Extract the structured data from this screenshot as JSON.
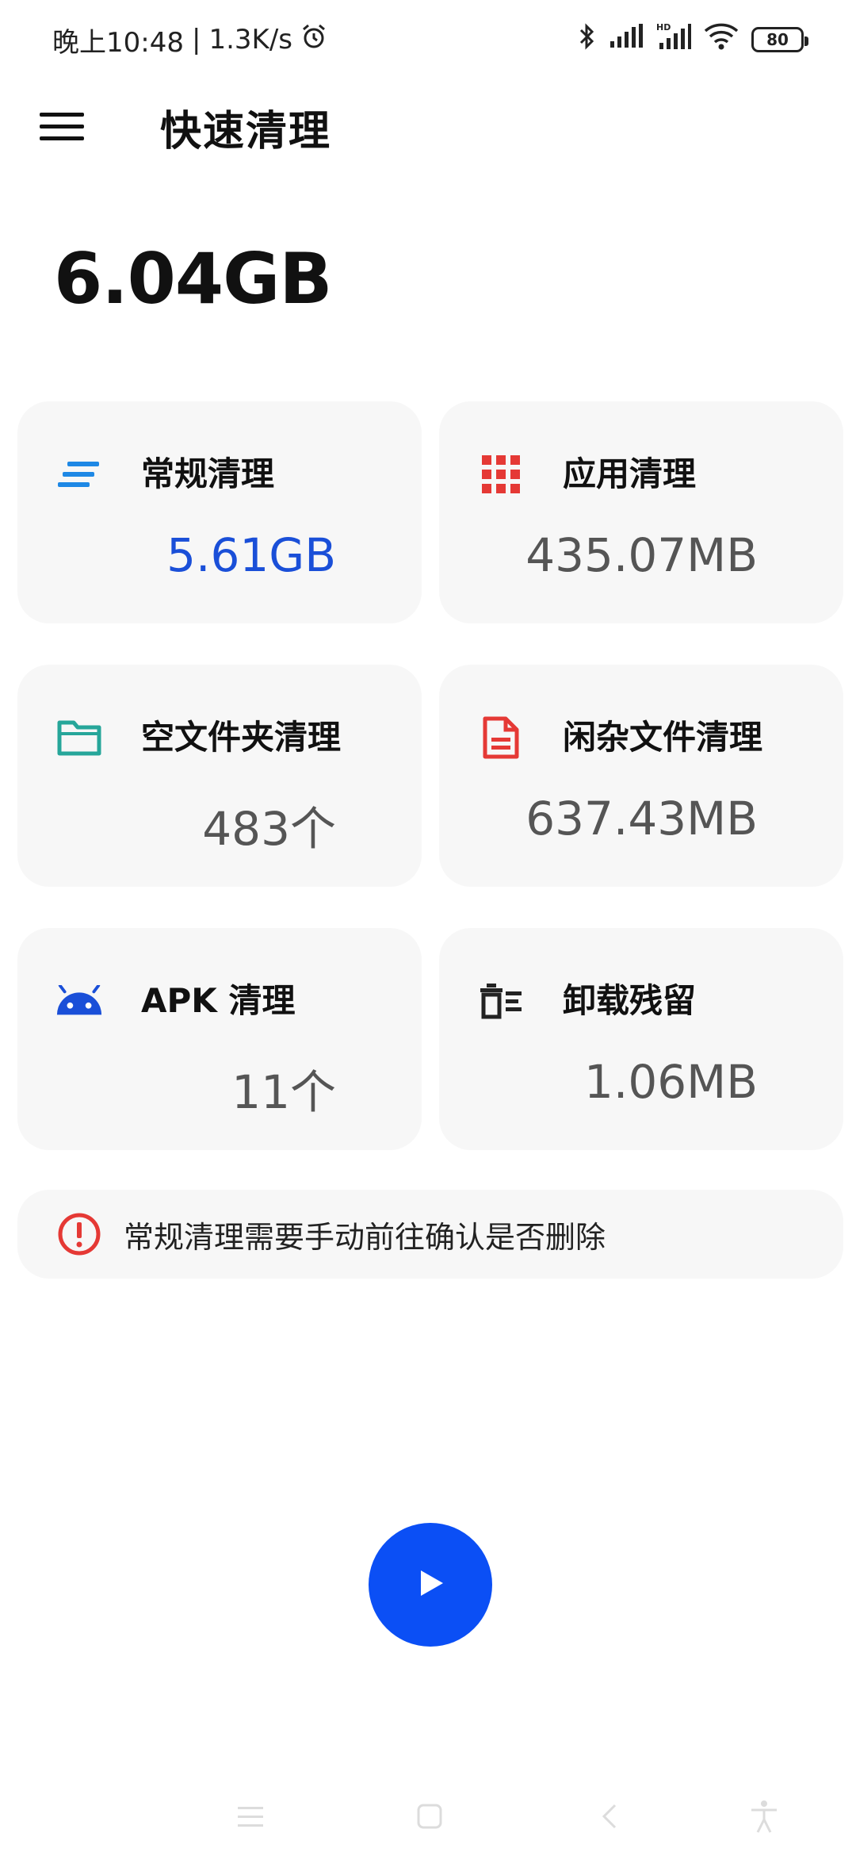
{
  "status_bar": {
    "time": "晚上10:48",
    "separator": "|",
    "network_speed": "1.3K/s",
    "battery": "80",
    "icons": [
      "alarm-icon",
      "bluetooth-icon",
      "signal-icon",
      "hd-signal-icon",
      "wifi-icon",
      "battery-icon"
    ]
  },
  "app_bar": {
    "title": "快速清理",
    "menu_icon": "menu-icon"
  },
  "summary": {
    "total_size": "6.04GB"
  },
  "cards": [
    {
      "title": "常规清理",
      "value": "5.61GB",
      "icon": "lines-icon",
      "value_color": "#1a4fd8"
    },
    {
      "title": "应用清理",
      "value": "435.07MB",
      "icon": "app-grid-icon"
    },
    {
      "title": "空文件夹清理",
      "value": "483个",
      "icon": "folder-icon"
    },
    {
      "title": "闲杂文件清理",
      "value": "637.43MB",
      "icon": "document-icon"
    },
    {
      "title": "APK 清理",
      "value": "11个",
      "icon": "android-icon"
    },
    {
      "title": "卸载残留",
      "value": "1.06MB",
      "icon": "uninstall-residue-icon"
    }
  ],
  "notice": {
    "text": "常规清理需要手动前往确认是否删除",
    "icon": "alert-icon"
  },
  "fab": {
    "icon": "play-icon"
  },
  "nav_bar": {
    "icons": [
      "nav-menu-icon",
      "nav-home-icon",
      "nav-back-icon",
      "accessibility-icon"
    ]
  },
  "colors": {
    "accent_blue": "#0b4ff5",
    "value_blue": "#1a4fd8",
    "card_bg": "#f7f7f7",
    "red": "#e53935",
    "teal": "#26a69a"
  }
}
